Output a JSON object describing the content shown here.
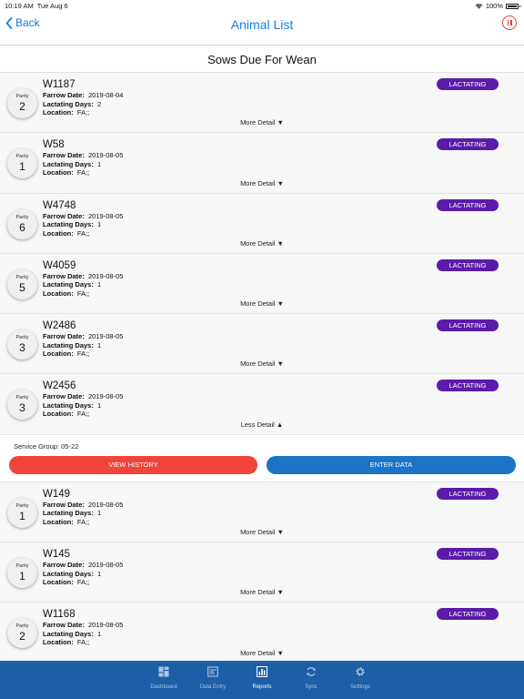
{
  "status_bar": {
    "time": "10:19 AM",
    "date": "Tue Aug 6",
    "battery": "100%"
  },
  "nav": {
    "back_label": "Back",
    "title": "Animal List"
  },
  "section_title": "Sows Due For Wean",
  "labels": {
    "parity": "Parity",
    "farrow_date": "Farrow Date:",
    "lactating_days": "Lactating Days:",
    "location": "Location:"
  },
  "animals": [
    {
      "id": "W1187",
      "parity": "2",
      "farrow_date": "2019-08-04",
      "lactating_days": "2",
      "location": "FA;;",
      "status": "LACTATING",
      "toggle": "More Detail ▼"
    },
    {
      "id": "W58",
      "parity": "1",
      "farrow_date": "2019-08-05",
      "lactating_days": "1",
      "location": "FA;;",
      "status": "LACTATING",
      "toggle": "More Detail ▼"
    },
    {
      "id": "W4748",
      "parity": "6",
      "farrow_date": "2019-08-05",
      "lactating_days": "1",
      "location": "FA;;",
      "status": "LACTATING",
      "toggle": "More Detail ▼"
    },
    {
      "id": "W4059",
      "parity": "5",
      "farrow_date": "2019-08-05",
      "lactating_days": "1",
      "location": "FA;;",
      "status": "LACTATING",
      "toggle": "More Detail ▼"
    },
    {
      "id": "W2486",
      "parity": "3",
      "farrow_date": "2019-08-05",
      "lactating_days": "1",
      "location": "FA;;",
      "status": "LACTATING",
      "toggle": "More Detail ▼"
    },
    {
      "id": "W2456",
      "parity": "3",
      "farrow_date": "2019-08-05",
      "lactating_days": "1",
      "location": "FA;;",
      "status": "LACTATING",
      "toggle": "Less Detail ▲",
      "expanded": true
    },
    {
      "id": "W149",
      "parity": "1",
      "farrow_date": "2019-08-05",
      "lactating_days": "1",
      "location": "FA;;",
      "status": "LACTATING",
      "toggle": "More Detail ▼"
    },
    {
      "id": "W145",
      "parity": "1",
      "farrow_date": "2019-08-05",
      "lactating_days": "1",
      "location": "FA;;",
      "status": "LACTATING",
      "toggle": "More Detail ▼"
    },
    {
      "id": "W1168",
      "parity": "2",
      "farrow_date": "2019-08-05",
      "lactating_days": "1",
      "location": "FA;;",
      "status": "LACTATING",
      "toggle": "More Detail ▼"
    }
  ],
  "expanded_detail": {
    "service_group": "Service Group: 05-22",
    "view_history_label": "VIEW HISTORY",
    "enter_data_label": "ENTER DATA"
  },
  "tabs": [
    {
      "label": "Dashboard",
      "icon": "dashboard-icon",
      "active": false
    },
    {
      "label": "Data Entry",
      "icon": "data-entry-icon",
      "active": false
    },
    {
      "label": "Reports",
      "icon": "reports-icon",
      "active": true
    },
    {
      "label": "Sync",
      "icon": "sync-icon",
      "active": false
    },
    {
      "label": "Settings",
      "icon": "settings-icon",
      "active": false
    }
  ],
  "colors": {
    "accent_blue": "#1a7de0",
    "badge_purple": "#5b1ba8",
    "history_red": "#f0443a",
    "enter_blue": "#1b74c8",
    "tab_bar": "#1d5fa6"
  }
}
